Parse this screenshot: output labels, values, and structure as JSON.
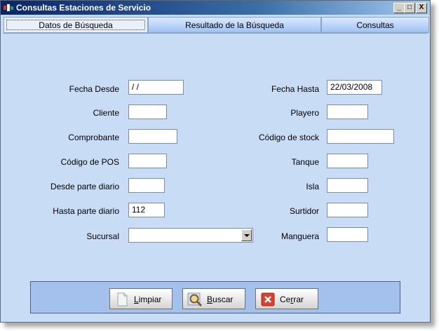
{
  "window": {
    "title": "Consultas Estaciones de Servicio",
    "controls": {
      "minimize": "_",
      "maximize": "□",
      "close": "X"
    }
  },
  "tabs": [
    {
      "label": "Datos de Búsqueda",
      "active": true
    },
    {
      "label": "Resultado de la Búsqueda",
      "active": false
    },
    {
      "label": "Consultas",
      "active": false
    }
  ],
  "form": {
    "fecha_desde": {
      "label": "Fecha Desde",
      "value": " / /"
    },
    "cliente": {
      "label": "Cliente",
      "value": ""
    },
    "comprobante": {
      "label": "Comprobante",
      "value": ""
    },
    "codigo_pos": {
      "label": "Código de POS",
      "value": ""
    },
    "desde_parte": {
      "label": "Desde parte diario",
      "value": ""
    },
    "hasta_parte": {
      "label": "Hasta parte diario",
      "value": "112"
    },
    "sucursal": {
      "label": "Sucursal",
      "value": ""
    },
    "fecha_hasta": {
      "label": "Fecha Hasta",
      "value": "22/03/2008"
    },
    "playero": {
      "label": "Playero",
      "value": ""
    },
    "codigo_stock": {
      "label": "Código de stock",
      "value": ""
    },
    "tanque": {
      "label": "Tanque",
      "value": ""
    },
    "isla": {
      "label": "Isla",
      "value": ""
    },
    "surtidor": {
      "label": "Surtidor",
      "value": ""
    },
    "manguera": {
      "label": "Manguera",
      "value": ""
    }
  },
  "buttons": {
    "limpiar": {
      "hotkey": "L",
      "rest": "impiar"
    },
    "buscar": {
      "hotkey": "B",
      "rest": "uscar"
    },
    "cerrar": {
      "pre": "Ce",
      "hotkey": "r",
      "rest": "rar"
    }
  },
  "colors": {
    "title_start": "#0a246a",
    "title_end": "#a6caf0",
    "panel": "#c8dcf6",
    "button_bar": "#a3c1ec",
    "close_icon": "#d9432c"
  },
  "icons": {
    "app": "app-icon",
    "limpiar": "document-icon",
    "buscar": "magnifier-icon",
    "cerrar": "close-x-icon"
  }
}
